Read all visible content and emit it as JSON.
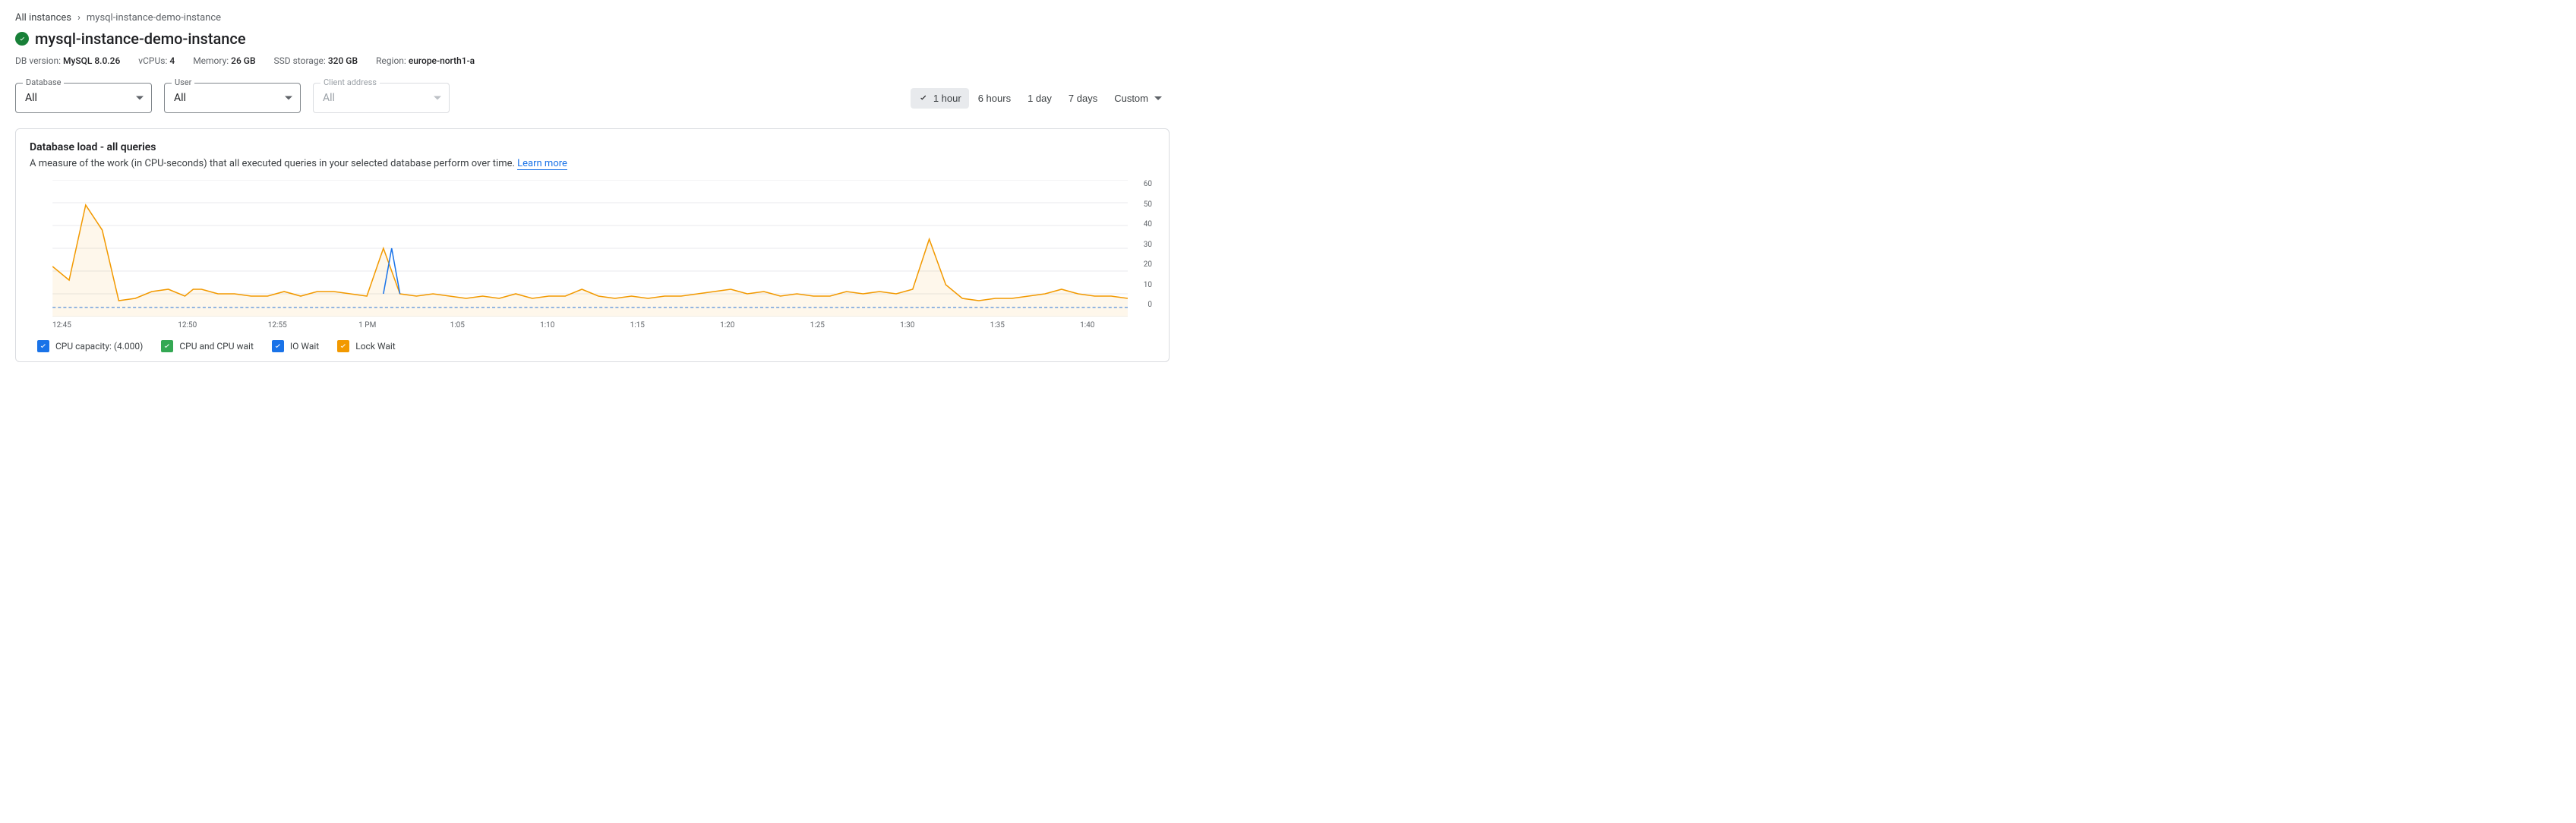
{
  "breadcrumb": {
    "root": "All instances",
    "current": "mysql-instance-demo-instance"
  },
  "title": "mysql-instance-demo-instance",
  "meta": {
    "db_version_label": "DB version:",
    "db_version": "MySQL 8.0.26",
    "vcpus_label": "vCPUs:",
    "vcpus": "4",
    "memory_label": "Memory:",
    "memory": "26 GB",
    "ssd_label": "SSD storage:",
    "ssd": "320 GB",
    "region_label": "Region:",
    "region": "europe-north1-a"
  },
  "filters": {
    "database": {
      "label": "Database",
      "value": "All"
    },
    "user": {
      "label": "User",
      "value": "All"
    },
    "client": {
      "label": "Client address",
      "value": "All"
    }
  },
  "time_range": {
    "options": [
      "1 hour",
      "6 hours",
      "1 day",
      "7 days",
      "Custom"
    ],
    "active": "1 hour"
  },
  "card": {
    "title": "Database load - all queries",
    "description": "A measure of the work (in CPU-seconds) that all executed queries in your selected database perform over time.",
    "learn_more": "Learn more"
  },
  "legend": {
    "cpu_capacity": "CPU capacity: (4.000)",
    "cpu_wait": "CPU and CPU wait",
    "io_wait": "IO Wait",
    "lock_wait": "Lock Wait"
  },
  "chart_data": {
    "type": "area",
    "ylim": [
      0,
      60
    ],
    "y_ticks": [
      60,
      50,
      40,
      30,
      20,
      10,
      0
    ],
    "x_ticks": [
      "12:45",
      "12:50",
      "12:55",
      "1 PM",
      "1:05",
      "1:10",
      "1:15",
      "1:20",
      "1:25",
      "1:30",
      "1:35",
      "1:40"
    ],
    "cpu_capacity_value": 4.0,
    "colors": {
      "cpu_capacity": "#1a73e8",
      "cpu_wait": "#34a853",
      "io_wait": "#1a73e8",
      "lock_wait": "#f29900"
    },
    "series": [
      {
        "name": "Lock Wait",
        "color": "#f29900",
        "points": [
          [
            0,
            22
          ],
          [
            1,
            16
          ],
          [
            2,
            49
          ],
          [
            3,
            38
          ],
          [
            4,
            7
          ],
          [
            5,
            8
          ],
          [
            6,
            11
          ],
          [
            7,
            12
          ],
          [
            8,
            9
          ],
          [
            8.5,
            12
          ],
          [
            9,
            12
          ],
          [
            10,
            10
          ],
          [
            11,
            10
          ],
          [
            12,
            9
          ],
          [
            13,
            9
          ],
          [
            14,
            11
          ],
          [
            15,
            9
          ],
          [
            16,
            11
          ],
          [
            17,
            11
          ],
          [
            18,
            10
          ],
          [
            19,
            9
          ],
          [
            20,
            30
          ],
          [
            21,
            10
          ],
          [
            22,
            9
          ],
          [
            23,
            10
          ],
          [
            24,
            9
          ],
          [
            25,
            8
          ],
          [
            26,
            9
          ],
          [
            27,
            8
          ],
          [
            28,
            10
          ],
          [
            29,
            8
          ],
          [
            30,
            9
          ],
          [
            31,
            9
          ],
          [
            32,
            12
          ],
          [
            33,
            9
          ],
          [
            34,
            8
          ],
          [
            35,
            9
          ],
          [
            36,
            8
          ],
          [
            37,
            9
          ],
          [
            38,
            9
          ],
          [
            39,
            10
          ],
          [
            40,
            11
          ],
          [
            41,
            12
          ],
          [
            42,
            10
          ],
          [
            43,
            11
          ],
          [
            44,
            9
          ],
          [
            45,
            10
          ],
          [
            46,
            9
          ],
          [
            47,
            9
          ],
          [
            48,
            11
          ],
          [
            49,
            10
          ],
          [
            50,
            11
          ],
          [
            51,
            10
          ],
          [
            52,
            12
          ],
          [
            53,
            34
          ],
          [
            54,
            14
          ],
          [
            55,
            8
          ],
          [
            56,
            7
          ],
          [
            57,
            8
          ],
          [
            58,
            8
          ],
          [
            59,
            9
          ],
          [
            60,
            10
          ],
          [
            61,
            12
          ],
          [
            62,
            10
          ],
          [
            63,
            9
          ],
          [
            64,
            9
          ],
          [
            65,
            8
          ]
        ]
      },
      {
        "name": "IO Wait",
        "color": "#1a73e8",
        "points": [
          [
            20,
            10
          ],
          [
            20.5,
            30
          ],
          [
            21,
            10
          ]
        ]
      }
    ]
  }
}
